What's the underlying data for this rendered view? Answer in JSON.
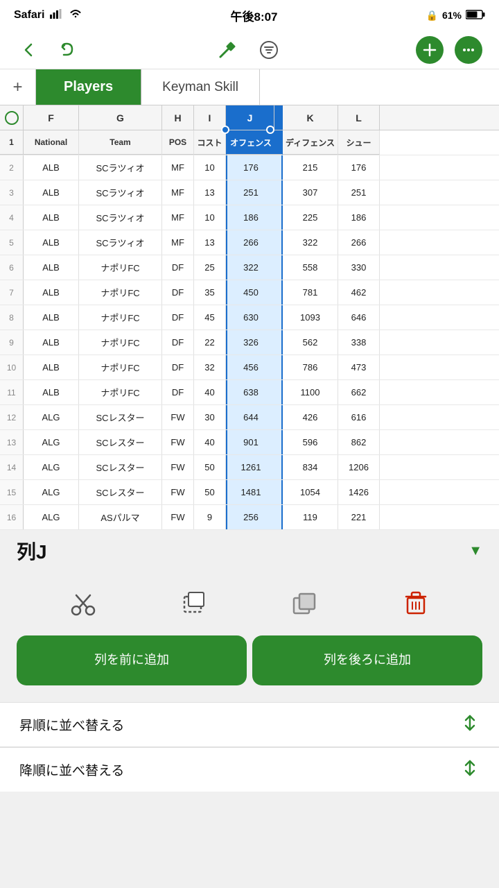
{
  "statusBar": {
    "app": "Safari",
    "time": "午後8:07",
    "battery": "61%"
  },
  "toolbar": {
    "backLabel": "‹",
    "undoLabel": "↩",
    "hammerLabel": "🔨",
    "filterLabel": "≡",
    "addLabel": "+",
    "moreLabel": "···"
  },
  "tabs": {
    "addLabel": "+",
    "active": "Players",
    "inactive": "Keyman Skill"
  },
  "columns": {
    "headers": [
      "F",
      "G",
      "H",
      "I",
      "J",
      "K",
      "L"
    ],
    "rowNum": "#"
  },
  "columnHeaders": {
    "national": "National",
    "team": "Team",
    "pos": "POS",
    "cost": "コスト",
    "offense": "オフェンス",
    "defense": "ディフェンス",
    "shoot": "シュー"
  },
  "rows": [
    {
      "num": 2,
      "national": "ALB",
      "team": "SCラツィオ",
      "pos": "MF",
      "cost": 10,
      "offense": 176,
      "defense": 215,
      "shoot": 176
    },
    {
      "num": 3,
      "national": "ALB",
      "team": "SCラツィオ",
      "pos": "MF",
      "cost": 13,
      "offense": 251,
      "defense": 307,
      "shoot": 251
    },
    {
      "num": 4,
      "national": "ALB",
      "team": "SCラツィオ",
      "pos": "MF",
      "cost": 10,
      "offense": 186,
      "defense": 225,
      "shoot": 186
    },
    {
      "num": 5,
      "national": "ALB",
      "team": "SCラツィオ",
      "pos": "MF",
      "cost": 13,
      "offense": 266,
      "defense": 322,
      "shoot": 266
    },
    {
      "num": 6,
      "national": "ALB",
      "team": "ナポリFC",
      "pos": "DF",
      "cost": 25,
      "offense": 322,
      "defense": 558,
      "shoot": 330
    },
    {
      "num": 7,
      "national": "ALB",
      "team": "ナポリFC",
      "pos": "DF",
      "cost": 35,
      "offense": 450,
      "defense": 781,
      "shoot": 462
    },
    {
      "num": 8,
      "national": "ALB",
      "team": "ナポリFC",
      "pos": "DF",
      "cost": 45,
      "offense": 630,
      "defense": 1093,
      "shoot": 646
    },
    {
      "num": 9,
      "national": "ALB",
      "team": "ナポリFC",
      "pos": "DF",
      "cost": 22,
      "offense": 326,
      "defense": 562,
      "shoot": 338
    },
    {
      "num": 10,
      "national": "ALB",
      "team": "ナポリFC",
      "pos": "DF",
      "cost": 32,
      "offense": 456,
      "defense": 786,
      "shoot": 473
    },
    {
      "num": 11,
      "national": "ALB",
      "team": "ナポリFC",
      "pos": "DF",
      "cost": 40,
      "offense": 638,
      "defense": 1100,
      "shoot": 662
    },
    {
      "num": 12,
      "national": "ALG",
      "team": "SCレスター",
      "pos": "FW",
      "cost": 30,
      "offense": 644,
      "defense": 426,
      "shoot": 616
    },
    {
      "num": 13,
      "national": "ALG",
      "team": "SCレスター",
      "pos": "FW",
      "cost": 40,
      "offense": 901,
      "defense": 596,
      "shoot": 862
    },
    {
      "num": 14,
      "national": "ALG",
      "team": "SCレスター",
      "pos": "FW",
      "cost": 50,
      "offense": 1261,
      "defense": 834,
      "shoot": 1206
    },
    {
      "num": 15,
      "national": "ALG",
      "team": "SCレスター",
      "pos": "FW",
      "cost": 50,
      "offense": 1481,
      "defense": 1054,
      "shoot": 1426
    },
    {
      "num": 16,
      "national": "ALG",
      "team": "ASパルマ",
      "pos": "FW",
      "cost": 9,
      "offense": 256,
      "defense": 119,
      "shoot": 221
    }
  ],
  "bottomPanel": {
    "columnLabel": "列J",
    "dropdownArrow": "▼",
    "actions": {
      "cut": "✂",
      "copySelection": "⬚",
      "paste": "⬜",
      "delete": "🗑"
    },
    "addBeforeLabel1": "列を前に",
    "addBeforeLabel2": "追加",
    "addAfterLabel1": "列を後ろに",
    "addAfterLabel2": "追加",
    "sortAsc": "昇順に並べ替える",
    "sortDesc": "降順に並べ替える"
  }
}
